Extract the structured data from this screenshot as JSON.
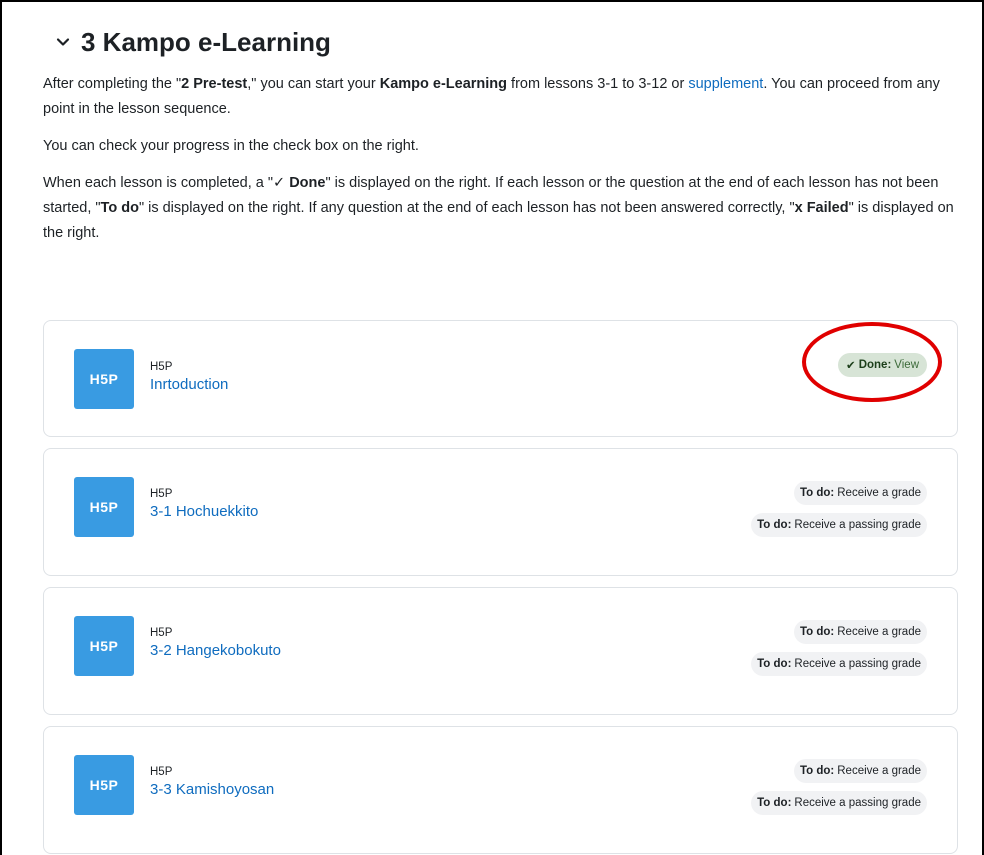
{
  "section": {
    "title": "3 Kampo e-Learning",
    "chevron_icon": "chevron-down-icon"
  },
  "summary": {
    "p1_a": "After completing the \"",
    "p1_b": "2 Pre-test",
    "p1_c": ",\" you can start your ",
    "p1_d": "Kampo e-Learning",
    "p1_e": " from lessons 3-1 to 3-12 or ",
    "p1_link": "supplement",
    "p1_f": ". You can proceed from any point in the lesson sequence.",
    "p2": "You can check your progress in the check box on the right.",
    "p3_a": "When each lesson is completed, a \"",
    "p3_b": "✓ Done",
    "p3_c": "\" is displayed on the right. If each lesson or the question at the end of each lesson has not been started, \"",
    "p3_d": "To do",
    "p3_e": "\" is displayed on the right. If any question at the end of each lesson has not been answered correctly, \"",
    "p3_f": "x Failed",
    "p3_g": "\" is displayed on the right."
  },
  "activities": [
    {
      "icon_text": "H5P",
      "type": "H5P",
      "name": "Inrtoduction",
      "done": {
        "label": "Done:",
        "action": "View"
      }
    },
    {
      "icon_text": "H5P",
      "type": "H5P",
      "name": "3-1 Hochuekkito",
      "todo": [
        {
          "label": "To do:",
          "text": "Receive a grade"
        },
        {
          "label": "To do:",
          "text": "Receive a passing grade"
        }
      ]
    },
    {
      "icon_text": "H5P",
      "type": "H5P",
      "name": "3-2 Hangekobokuto",
      "todo": [
        {
          "label": "To do:",
          "text": "Receive a grade"
        },
        {
          "label": "To do:",
          "text": "Receive a passing grade"
        }
      ]
    },
    {
      "icon_text": "H5P",
      "type": "H5P",
      "name": "3-3 Kamishoyosan",
      "todo": [
        {
          "label": "To do:",
          "text": "Receive a grade"
        },
        {
          "label": "To do:",
          "text": "Receive a passing grade"
        }
      ]
    }
  ],
  "colors": {
    "link": "#0f6cbf",
    "h5p_icon_bg": "#399be2",
    "done_bg": "#d7e4d6",
    "todo_bg": "#f1f2f4",
    "annotation_ring": "#e00000"
  }
}
